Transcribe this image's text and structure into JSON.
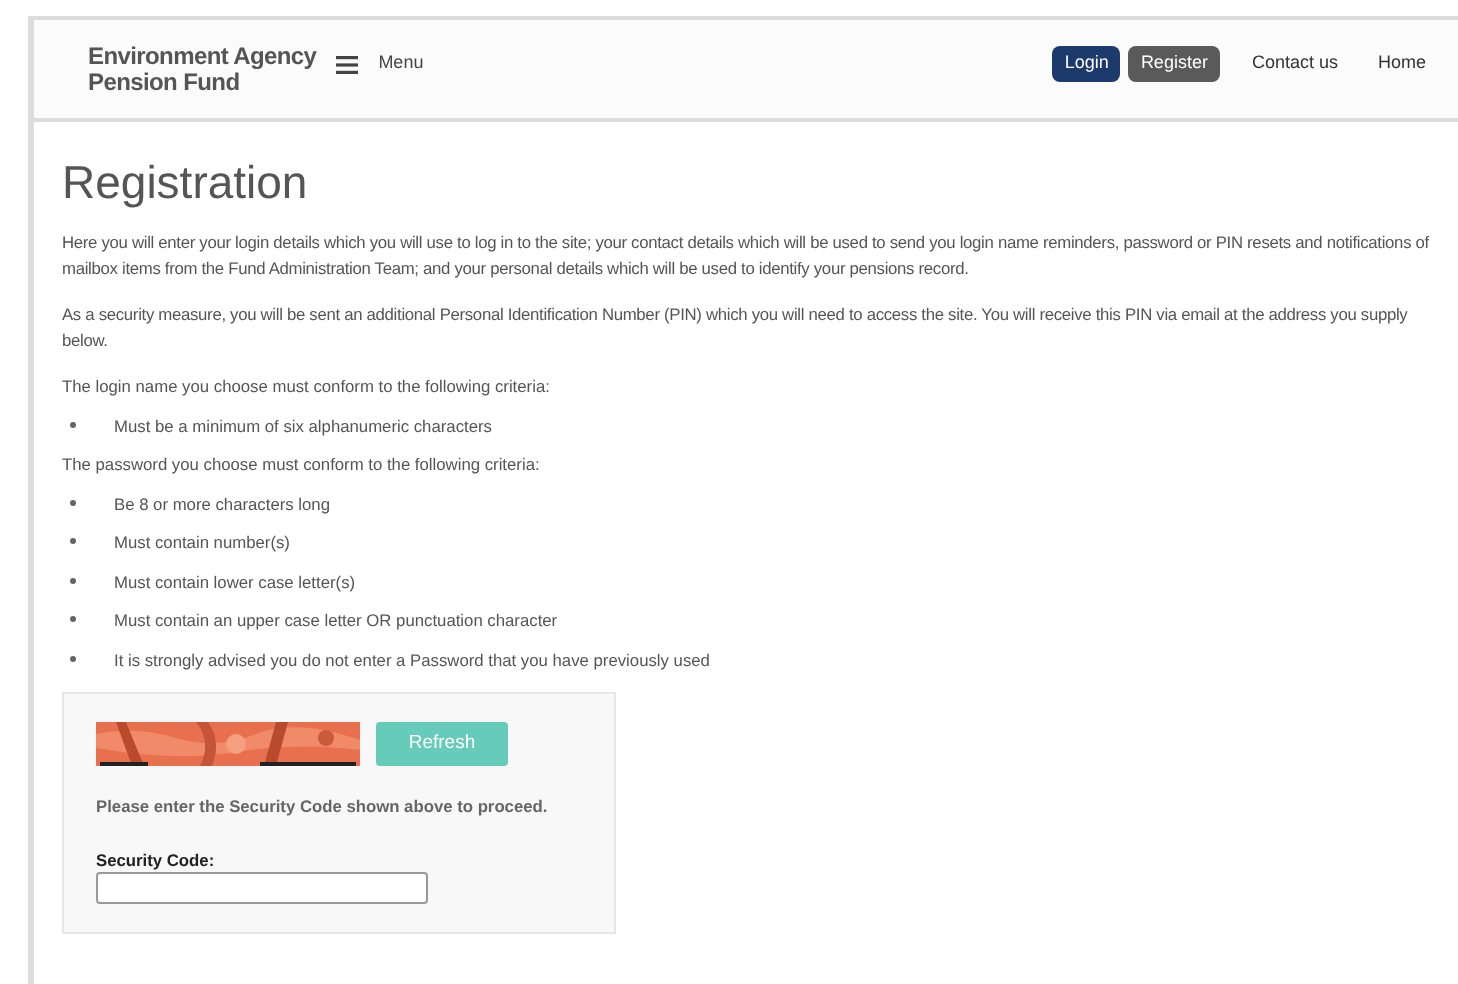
{
  "header": {
    "logo_line1": "Environment Agency",
    "logo_line2": "Pension Fund",
    "menu_label": "Menu",
    "nav": [
      {
        "label": "Login",
        "kind": "primary"
      },
      {
        "label": "Register",
        "kind": "secondary"
      },
      {
        "label": "Contact us",
        "kind": "link"
      },
      {
        "label": "Home",
        "kind": "link"
      }
    ]
  },
  "title": "Registration",
  "intro": [
    "Here you will enter your login details which you will use to log in to the site; your contact details which will be used to send you login name reminders, password or PIN resets and notifications of mailbox items from the Fund Administration Team; and your personal details which will be used to identify your pensions record.",
    "As a security measure, you will be sent an additional Personal Identification Number (PIN) which you will need to access the site. You will receive this PIN via email at the address you supply below."
  ],
  "login_criteria": {
    "heading": "The login name you choose must conform to the following criteria:",
    "items": [
      "Must be a minimum of six alphanumeric characters"
    ]
  },
  "password_criteria": {
    "heading": "The password you choose must conform to the following criteria:",
    "items": [
      "Be 8 or more characters long",
      "Must contain number(s)",
      "Must contain lower case letter(s)",
      "Must contain an upper case letter OR punctuation character",
      "It is strongly advised you do not enter a Password that you have previously used"
    ]
  },
  "captcha": {
    "refresh_label": "Refresh",
    "instruction": "Please enter the Security Code shown above to proceed.",
    "field_label": "Security Code:"
  }
}
